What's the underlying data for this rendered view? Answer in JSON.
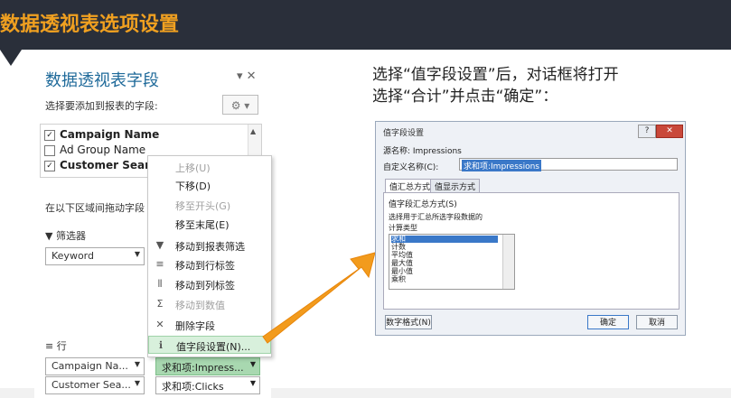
{
  "header": {
    "title": "数据透视表选项设置"
  },
  "pane": {
    "title": "数据透视表字段",
    "title_icons": "▾ ✕",
    "subtitle": "选择要添加到报表的字段:",
    "gear": "⚙ ▾",
    "fields": [
      {
        "label": "Campaign Name",
        "checked": true,
        "check_mark": "✓"
      },
      {
        "label": "Ad Group Name",
        "checked": false,
        "check_mark": ""
      },
      {
        "label": "Customer Search",
        "checked": true,
        "check_mark": "✓"
      }
    ],
    "scroll_up": "▲",
    "drag_text": "在以下区域间拖动字段",
    "filters_label": "筛选器",
    "filters_icon": "▼",
    "filter_value": "Keyword",
    "rows_label": "行",
    "rows_icon": "≡",
    "rows": [
      {
        "value": "Campaign Na..."
      },
      {
        "value": "Customer Sea..."
      }
    ],
    "values": [
      {
        "value": "求和项:Impress...",
        "highlighted": true
      },
      {
        "value": "求和项:Clicks",
        "highlighted": false
      }
    ],
    "dropdown_arrow": "▼"
  },
  "menu": {
    "items": [
      {
        "icon": "",
        "label": "上移(U)",
        "disabled": true,
        "selected": false
      },
      {
        "icon": "",
        "label": "下移(D)",
        "disabled": false,
        "selected": false
      },
      {
        "icon": "",
        "label": "移至开头(G)",
        "disabled": true,
        "selected": false
      },
      {
        "icon": "",
        "label": "移至末尾(E)",
        "disabled": false,
        "selected": false
      },
      {
        "icon": "▼",
        "label": "移动到报表筛选",
        "disabled": false,
        "selected": false
      },
      {
        "icon": "≡",
        "label": "移动到行标签",
        "disabled": false,
        "selected": false
      },
      {
        "icon": "⦀",
        "label": "移动到列标签",
        "disabled": false,
        "selected": false
      },
      {
        "icon": "Σ",
        "label": "移动到数值",
        "disabled": true,
        "selected": false
      },
      {
        "icon": "✕",
        "label": "删除字段",
        "disabled": false,
        "selected": false
      },
      {
        "icon": "ℹ",
        "label": "值字段设置(N)...",
        "disabled": false,
        "selected": true
      }
    ]
  },
  "instruction": {
    "line1": "选择“值字段设置”后，对话框将打开",
    "line2": "选择“合计”并点击“确定”："
  },
  "dialog": {
    "title": "值字段设置",
    "help": "?",
    "close": "✕",
    "source_label": "源名称: Impressions",
    "custom_name_label": "自定义名称(C):",
    "custom_name_value": "求和项:Impressions",
    "tabs": [
      "值汇总方式",
      "值显示方式"
    ],
    "section": "值字段汇总方式(S)",
    "desc": "选择用于汇总所选字段数据的",
    "calc_type": "计算类型",
    "list": [
      "求和",
      "计数",
      "平均值",
      "最大值",
      "最小值",
      "乘积"
    ],
    "selected_index": 0,
    "number_format_btn": "数字格式(N)",
    "ok_btn": "确定",
    "cancel_btn": "取消"
  },
  "colors": {
    "header_bg": "#2a2f3a",
    "header_text": "#f0a020",
    "arrow": "#f29b1d",
    "highlight": "#a8d8b0"
  }
}
